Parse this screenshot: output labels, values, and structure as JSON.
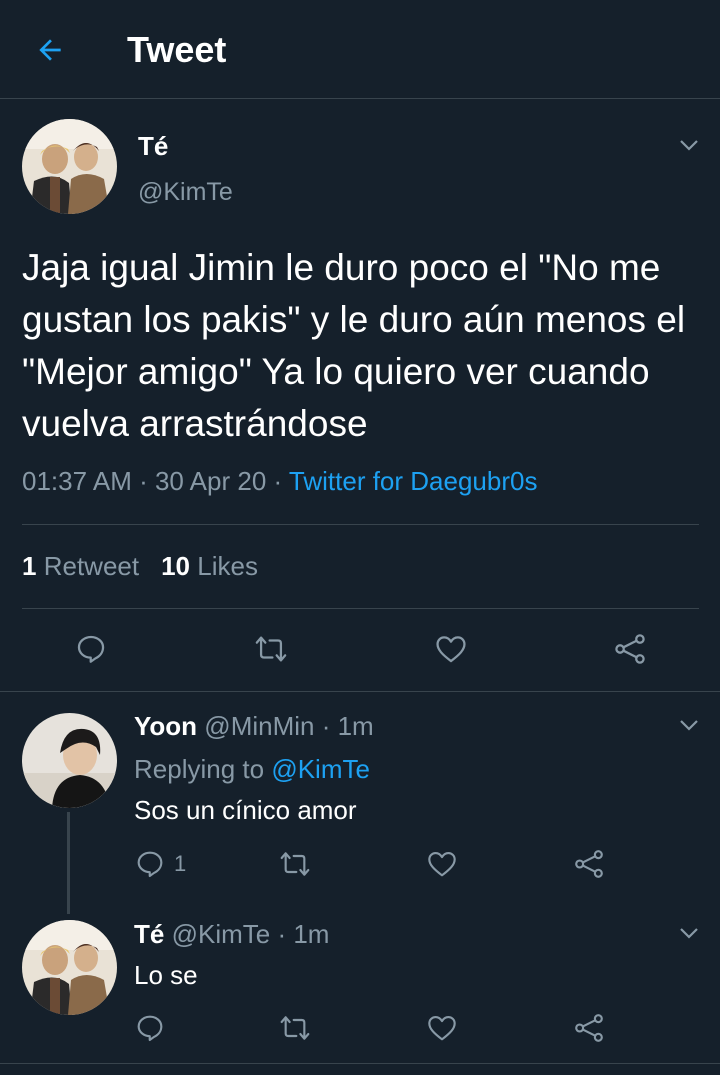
{
  "header": {
    "title": "Tweet",
    "back_icon": "arrow-left-icon",
    "accent": "#1da1f2"
  },
  "main_tweet": {
    "name": "Té",
    "handle": "@KimTe",
    "text": "Jaja igual Jimin le duro poco el \"No me gustan los pakis\" y le duro aún menos el \"Mejor amigo\" Ya lo quiero ver cuando vuelva arrastrándose",
    "time": "01:37 AM",
    "sep1": " · ",
    "date": "30 Apr 20",
    "sep2": " · ",
    "source": "Twitter for Daegubr0s",
    "retweet_count": "1",
    "retweet_label": "Retweet",
    "likes_count": "10",
    "likes_label": "Likes"
  },
  "replies": [
    {
      "name": "Yoon",
      "handle": "@MinMin",
      "time_sep": " · ",
      "time": "1m",
      "replying_label": "Replying to",
      "replying_handle": "@KimTe",
      "text": "Sos un cínico amor",
      "reply_count": "1"
    },
    {
      "name": "Té",
      "handle": "@KimTe",
      "time_sep": " · ",
      "time": "1m",
      "text": "Lo se"
    }
  ],
  "icons": {
    "reply": "reply-icon",
    "retweet": "retweet-icon",
    "like": "heart-icon",
    "share": "share-icon",
    "more": "chevron-down-icon"
  },
  "colors": {
    "background": "#15202b",
    "secondary_text": "#8899a6",
    "divider": "#38444d",
    "link": "#1da1f2"
  }
}
